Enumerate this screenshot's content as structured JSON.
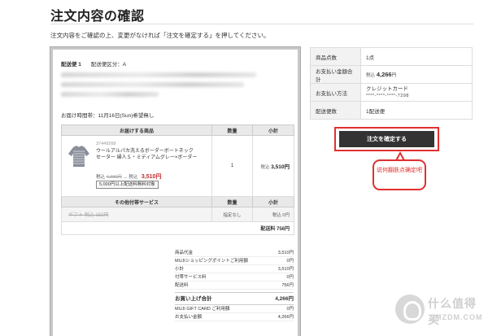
{
  "page": {
    "title": "注文内容の確認",
    "lead": "注文内容をご確認の上、変更がなければ「注文を確定する」を押してください。"
  },
  "shipment": {
    "label": "配送便 1",
    "category": "配送便区分：A",
    "delivery_time": "お届け時間帯：11月16日(Sun)希望無し"
  },
  "items_table": {
    "headers": [
      "お届けする商品",
      "数量",
      "小計"
    ],
    "product": {
      "sku": "37449268",
      "name": "ウールアルパカ洗えるボーダーボートネックセーター 婦人Ｓ・ミディアムグレー×ボーダー",
      "price_prefix": "税込",
      "original_price": "4,980円",
      "arrow": "→",
      "sale_prefix": "税込",
      "sale_price": "3,510円",
      "free_badge": "5,000円以上配送料無料対象",
      "quantity": "1",
      "subtotal_prefix": "税込",
      "subtotal": "3,510円"
    },
    "service_headers": [
      "その他付帯サービス",
      "数量",
      "小計"
    ],
    "service": {
      "name": "ギフト",
      "price": "税込 162円",
      "quantity": "指定なし",
      "subtotal": "税込 0円"
    },
    "shipping_line": "配送料 756円"
  },
  "summary": {
    "rows": [
      {
        "label": "商品代金",
        "value": "3,510円"
      },
      {
        "label": "MUJIショッピングポイントご利用額",
        "value": "0円"
      },
      {
        "label": "小計",
        "value": "3,510円"
      },
      {
        "label": "付帯サービス料",
        "value": "0円"
      },
      {
        "label": "配送料",
        "value": "756円"
      }
    ],
    "total_label": "お買い上げ合計",
    "total_value": "4,266円",
    "after_rows": [
      {
        "label": "MUJI GIFT CARD ご利用額",
        "value": "0円"
      },
      {
        "label": "お支払い金額",
        "value": "4,266円"
      }
    ]
  },
  "side": {
    "rows": [
      {
        "label": "商品点数",
        "value": "1点"
      },
      {
        "label": "お支払い金額合計",
        "value_prefix": "税込",
        "value": "4,266",
        "value_suffix": "円"
      },
      {
        "label": "お支払い方法",
        "value": "クレジットカード",
        "sub": "****-****-****-7298"
      },
      {
        "label": "配送便数",
        "value": "1配送便"
      }
    ],
    "confirm_button": "注文を確定する",
    "callout": "说何翻肤点确定吧"
  },
  "watermark": {
    "cn": "什么值得买",
    "en": "SMZDM.COM"
  },
  "colors": {
    "accent_red": "#e0302f",
    "price_red": "#c0272d",
    "button_dark": "#333333"
  }
}
